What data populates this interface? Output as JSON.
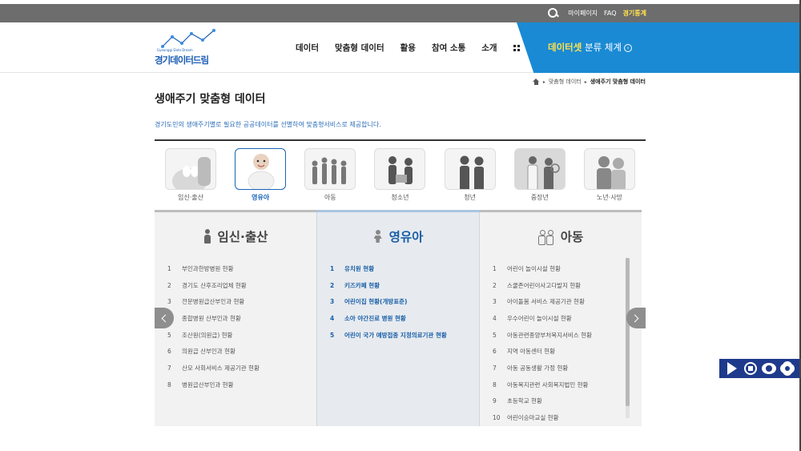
{
  "topbar": {
    "links": [
      "마이페이지",
      "FAQ"
    ],
    "highlight": "경기통계"
  },
  "header": {
    "logo_sub": "Gyeonggi Data Dream",
    "logo_text": "경기데이터드림",
    "nav": [
      "데이터",
      "맞춤형 데이터",
      "활용",
      "참여 소통",
      "소개"
    ],
    "catalog_highlight": "데이터셋",
    "catalog_rest": " 분류 체계"
  },
  "breadcrumb": {
    "items": [
      "맞춤형 데이터",
      "생애주기 맞춤형 데이터"
    ]
  },
  "page": {
    "title": "생애주기 맞춤형 데이터",
    "description": "경기도민의 생애주기별로 필요한 공공데이터를 선별하여 맞춤형서비스로 제공합니다."
  },
  "categories": [
    {
      "label": "임신·출산",
      "active": false
    },
    {
      "label": "영유아",
      "active": true
    },
    {
      "label": "아동",
      "active": false
    },
    {
      "label": "청소년",
      "active": false
    },
    {
      "label": "청년",
      "active": false
    },
    {
      "label": "중장년",
      "active": false
    },
    {
      "label": "노년·사망",
      "active": false
    }
  ],
  "panels": [
    {
      "title": "임신·출산",
      "items": [
        {
          "num": "1",
          "text": "부인과한방병원 현황"
        },
        {
          "num": "2",
          "text": "경기도 산후조리업체 현황"
        },
        {
          "num": "3",
          "text": "전문병원급산부인과 현황"
        },
        {
          "num": "4",
          "text": "종합병원 산부인과 현황"
        },
        {
          "num": "5",
          "text": "조산원(의원급) 현황"
        },
        {
          "num": "6",
          "text": "의원급 산부인과 현황"
        },
        {
          "num": "7",
          "text": "산모 사회서비스 제공기관 현황"
        },
        {
          "num": "8",
          "text": "병원급산부인과 현황"
        }
      ]
    },
    {
      "title": "영유아",
      "items": [
        {
          "num": "1",
          "text": "유치원 현황"
        },
        {
          "num": "2",
          "text": "키즈카페 현황"
        },
        {
          "num": "3",
          "text": "어린이집 현황(개방표준)"
        },
        {
          "num": "4",
          "text": "소아 야간진료 병원 현황"
        },
        {
          "num": "5",
          "text": "어린이 국가 예방접종 지정의료기관 현황"
        }
      ]
    },
    {
      "title": "아동",
      "items": [
        {
          "num": "1",
          "text": "어린이 놀이시설 현황"
        },
        {
          "num": "2",
          "text": "스쿨존어린이사고다발지 현황"
        },
        {
          "num": "3",
          "text": "아이돌봄 서비스 제공기관 현황"
        },
        {
          "num": "4",
          "text": "우수어린이 놀이시설 현황"
        },
        {
          "num": "5",
          "text": "아동관련종양부처복지서비스 현황"
        },
        {
          "num": "6",
          "text": "지역 아동센터 현황"
        },
        {
          "num": "7",
          "text": "아동 공동생활 가정 현황"
        },
        {
          "num": "8",
          "text": "아동복지관련 사회복지법인 현황"
        },
        {
          "num": "9",
          "text": "초등학교 현황"
        },
        {
          "num": "10",
          "text": "어린이승마교실 현황"
        }
      ]
    }
  ],
  "colors": {
    "accent_blue": "#1a8ad4",
    "active_blue": "#1a5fa8",
    "highlight_yellow": "#ffe14d",
    "toolbar_navy": "#1f3a8c"
  }
}
